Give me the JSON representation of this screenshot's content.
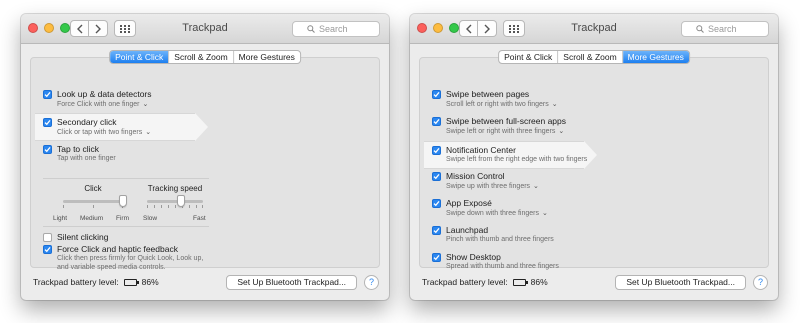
{
  "windows": {
    "left": {
      "title": "Trackpad",
      "search_placeholder": "Search",
      "tabs": [
        "Point & Click",
        "Scroll & Zoom",
        "More Gestures"
      ],
      "active_tab": 0,
      "settings": [
        {
          "title": "Look up & data detectors",
          "subtitle": "Force Click with one finger",
          "checked": true,
          "has_menu": true
        },
        {
          "title": "Secondary click",
          "subtitle": "Click or tap with two fingers",
          "checked": true,
          "has_menu": true,
          "highlighted": true
        },
        {
          "title": "Tap to click",
          "subtitle": "Tap with one finger",
          "checked": true,
          "has_menu": false
        }
      ],
      "sliders": [
        {
          "label": "Click",
          "ticks": [
            "Light",
            "Medium",
            "Firm"
          ],
          "value_fraction": 1.0
        },
        {
          "label": "Tracking speed",
          "ticks": [
            "Slow",
            "Fast"
          ],
          "value_fraction": 0.6
        }
      ],
      "extra_settings": [
        {
          "title": "Silent clicking",
          "checked": false
        },
        {
          "title": "Force Click and haptic feedback",
          "subtitle_lines": [
            "Click then press firmly for Quick Look, Look up,",
            "and variable speed media controls."
          ],
          "checked": true
        }
      ],
      "battery_label": "Trackpad battery level:",
      "battery_value": "86%",
      "setup_button": "Set Up Bluetooth Trackpad...",
      "help": "?"
    },
    "right": {
      "title": "Trackpad",
      "search_placeholder": "Search",
      "tabs": [
        "Point & Click",
        "Scroll & Zoom",
        "More Gestures"
      ],
      "active_tab": 2,
      "settings": [
        {
          "title": "Swipe between pages",
          "subtitle": "Scroll left or right with two fingers",
          "checked": true,
          "has_menu": true
        },
        {
          "title": "Swipe between full-screen apps",
          "subtitle": "Swipe left or right with three fingers",
          "checked": true,
          "has_menu": true
        },
        {
          "title": "Notification Center",
          "subtitle": "Swipe left from the right edge with two fingers",
          "checked": true,
          "has_menu": false,
          "highlighted": true
        },
        {
          "title": "Mission Control",
          "subtitle": "Swipe up with three fingers",
          "checked": true,
          "has_menu": true
        },
        {
          "title": "App Exposé",
          "subtitle": "Swipe down with three fingers",
          "checked": true,
          "has_menu": true
        },
        {
          "title": "Launchpad",
          "subtitle": "Pinch with thumb and three fingers",
          "checked": true,
          "has_menu": false
        },
        {
          "title": "Show Desktop",
          "subtitle": "Spread with thumb and three fingers",
          "checked": true,
          "has_menu": false
        }
      ],
      "battery_label": "Trackpad battery level:",
      "battery_value": "86%",
      "setup_button": "Set Up Bluetooth Trackpad...",
      "help": "?"
    }
  },
  "icons": {
    "close": "close-light-icon",
    "minimize": "minimize-light-icon",
    "maximize": "zoom-light-icon",
    "back": "chevron-left-icon",
    "forward": "chevron-right-icon",
    "grid": "grid-icon",
    "search": "search-icon",
    "checkbox": "checkmark-icon",
    "battery": "battery-icon",
    "menu": "chevron-down-icon"
  },
  "colors": {
    "accent": "#1d7ff0",
    "checkbox": "#2b87f0"
  }
}
